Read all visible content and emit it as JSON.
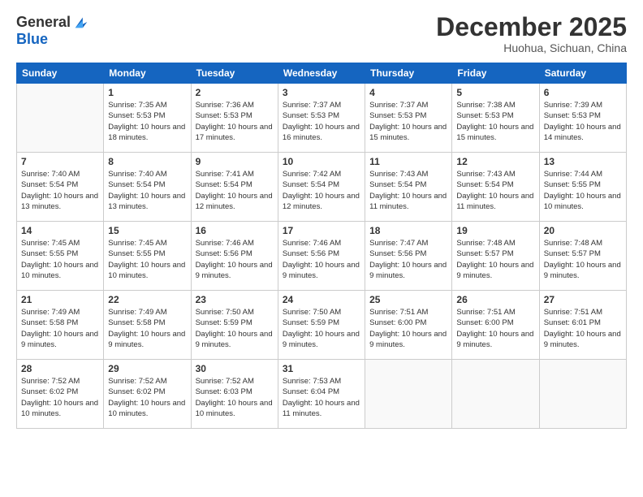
{
  "header": {
    "logo": {
      "general": "General",
      "blue": "Blue"
    },
    "month": "December 2025",
    "location": "Huohua, Sichuan, China"
  },
  "weekdays": [
    "Sunday",
    "Monday",
    "Tuesday",
    "Wednesday",
    "Thursday",
    "Friday",
    "Saturday"
  ],
  "weeks": [
    [
      {
        "day": "",
        "info": ""
      },
      {
        "day": "1",
        "info": "Sunrise: 7:35 AM\nSunset: 5:53 PM\nDaylight: 10 hours\nand 18 minutes."
      },
      {
        "day": "2",
        "info": "Sunrise: 7:36 AM\nSunset: 5:53 PM\nDaylight: 10 hours\nand 17 minutes."
      },
      {
        "day": "3",
        "info": "Sunrise: 7:37 AM\nSunset: 5:53 PM\nDaylight: 10 hours\nand 16 minutes."
      },
      {
        "day": "4",
        "info": "Sunrise: 7:37 AM\nSunset: 5:53 PM\nDaylight: 10 hours\nand 15 minutes."
      },
      {
        "day": "5",
        "info": "Sunrise: 7:38 AM\nSunset: 5:53 PM\nDaylight: 10 hours\nand 15 minutes."
      },
      {
        "day": "6",
        "info": "Sunrise: 7:39 AM\nSunset: 5:53 PM\nDaylight: 10 hours\nand 14 minutes."
      }
    ],
    [
      {
        "day": "7",
        "info": "Sunrise: 7:40 AM\nSunset: 5:54 PM\nDaylight: 10 hours\nand 13 minutes."
      },
      {
        "day": "8",
        "info": "Sunrise: 7:40 AM\nSunset: 5:54 PM\nDaylight: 10 hours\nand 13 minutes."
      },
      {
        "day": "9",
        "info": "Sunrise: 7:41 AM\nSunset: 5:54 PM\nDaylight: 10 hours\nand 12 minutes."
      },
      {
        "day": "10",
        "info": "Sunrise: 7:42 AM\nSunset: 5:54 PM\nDaylight: 10 hours\nand 12 minutes."
      },
      {
        "day": "11",
        "info": "Sunrise: 7:43 AM\nSunset: 5:54 PM\nDaylight: 10 hours\nand 11 minutes."
      },
      {
        "day": "12",
        "info": "Sunrise: 7:43 AM\nSunset: 5:54 PM\nDaylight: 10 hours\nand 11 minutes."
      },
      {
        "day": "13",
        "info": "Sunrise: 7:44 AM\nSunset: 5:55 PM\nDaylight: 10 hours\nand 10 minutes."
      }
    ],
    [
      {
        "day": "14",
        "info": "Sunrise: 7:45 AM\nSunset: 5:55 PM\nDaylight: 10 hours\nand 10 minutes."
      },
      {
        "day": "15",
        "info": "Sunrise: 7:45 AM\nSunset: 5:55 PM\nDaylight: 10 hours\nand 10 minutes."
      },
      {
        "day": "16",
        "info": "Sunrise: 7:46 AM\nSunset: 5:56 PM\nDaylight: 10 hours\nand 9 minutes."
      },
      {
        "day": "17",
        "info": "Sunrise: 7:46 AM\nSunset: 5:56 PM\nDaylight: 10 hours\nand 9 minutes."
      },
      {
        "day": "18",
        "info": "Sunrise: 7:47 AM\nSunset: 5:56 PM\nDaylight: 10 hours\nand 9 minutes."
      },
      {
        "day": "19",
        "info": "Sunrise: 7:48 AM\nSunset: 5:57 PM\nDaylight: 10 hours\nand 9 minutes."
      },
      {
        "day": "20",
        "info": "Sunrise: 7:48 AM\nSunset: 5:57 PM\nDaylight: 10 hours\nand 9 minutes."
      }
    ],
    [
      {
        "day": "21",
        "info": "Sunrise: 7:49 AM\nSunset: 5:58 PM\nDaylight: 10 hours\nand 9 minutes."
      },
      {
        "day": "22",
        "info": "Sunrise: 7:49 AM\nSunset: 5:58 PM\nDaylight: 10 hours\nand 9 minutes."
      },
      {
        "day": "23",
        "info": "Sunrise: 7:50 AM\nSunset: 5:59 PM\nDaylight: 10 hours\nand 9 minutes."
      },
      {
        "day": "24",
        "info": "Sunrise: 7:50 AM\nSunset: 5:59 PM\nDaylight: 10 hours\nand 9 minutes."
      },
      {
        "day": "25",
        "info": "Sunrise: 7:51 AM\nSunset: 6:00 PM\nDaylight: 10 hours\nand 9 minutes."
      },
      {
        "day": "26",
        "info": "Sunrise: 7:51 AM\nSunset: 6:00 PM\nDaylight: 10 hours\nand 9 minutes."
      },
      {
        "day": "27",
        "info": "Sunrise: 7:51 AM\nSunset: 6:01 PM\nDaylight: 10 hours\nand 9 minutes."
      }
    ],
    [
      {
        "day": "28",
        "info": "Sunrise: 7:52 AM\nSunset: 6:02 PM\nDaylight: 10 hours\nand 10 minutes."
      },
      {
        "day": "29",
        "info": "Sunrise: 7:52 AM\nSunset: 6:02 PM\nDaylight: 10 hours\nand 10 minutes."
      },
      {
        "day": "30",
        "info": "Sunrise: 7:52 AM\nSunset: 6:03 PM\nDaylight: 10 hours\nand 10 minutes."
      },
      {
        "day": "31",
        "info": "Sunrise: 7:53 AM\nSunset: 6:04 PM\nDaylight: 10 hours\nand 11 minutes."
      },
      {
        "day": "",
        "info": ""
      },
      {
        "day": "",
        "info": ""
      },
      {
        "day": "",
        "info": ""
      }
    ]
  ]
}
